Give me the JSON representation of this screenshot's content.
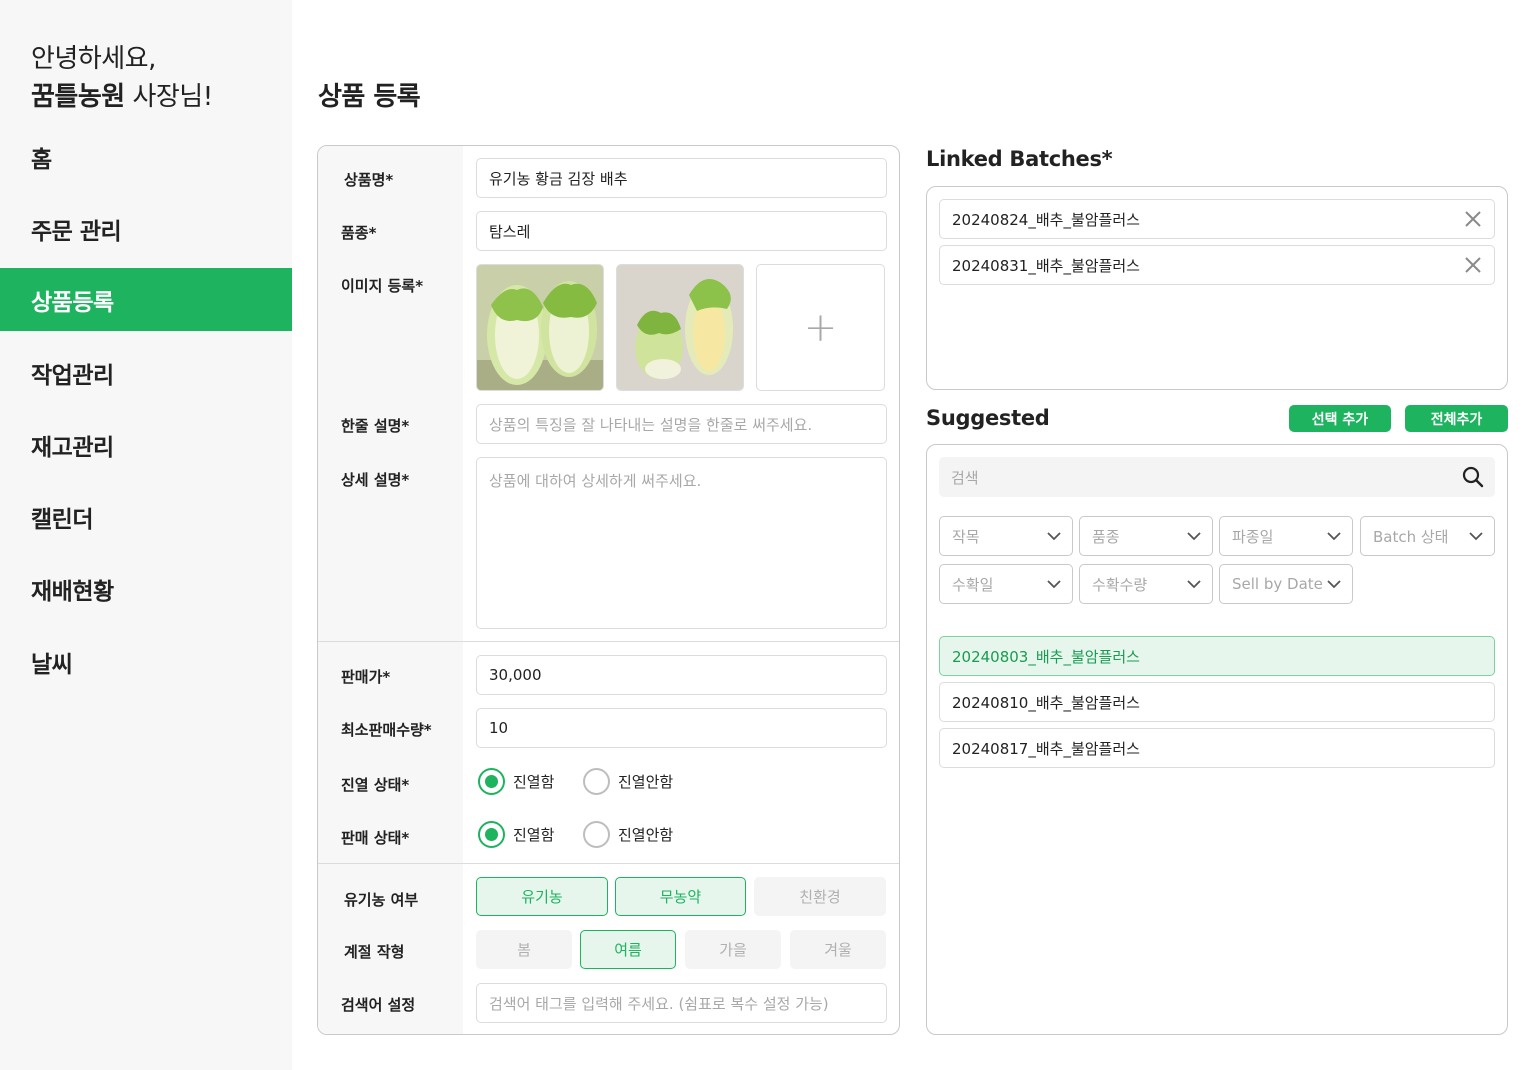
{
  "sidebar": {
    "greeting_line1": "안녕하세요,",
    "farm_name": "꿈틀농원",
    "greeting_suffix": " 사장님!",
    "items": [
      {
        "label": "홈"
      },
      {
        "label": "주문 관리"
      },
      {
        "label": "상품등록"
      },
      {
        "label": "작업관리"
      },
      {
        "label": "재고관리"
      },
      {
        "label": "캘린더"
      },
      {
        "label": "재배현황"
      },
      {
        "label": "날씨"
      }
    ],
    "active_index": 2
  },
  "page_title": "상품 등록",
  "form": {
    "product_name_label": "상품명*",
    "product_name_value": "유기농 황금 김장 배추",
    "variety_label": "품종*",
    "variety_value": "탐스레",
    "image_label": "이미지 등록*",
    "add_image_symbol": "+",
    "short_desc_label": "한줄 설명*",
    "short_desc_placeholder": "상품의 특징을 잘 나타내는 설명을 한줄로 써주세요.",
    "detail_desc_label": "상세 설명*",
    "detail_desc_placeholder": "상품에 대하여 상세하게 써주세요.",
    "price_label": "판매가*",
    "price_value": "30,000",
    "min_qty_label": "최소판매수량*",
    "min_qty_value": "10",
    "display_status_label": "진열 상태*",
    "display_options": [
      "진열함",
      "진열안함"
    ],
    "display_selected": "진열함",
    "sale_status_label": "판매 상태*",
    "sale_options": [
      "진열함",
      "진열안함"
    ],
    "sale_selected": "진열함",
    "organic_label": "유기농 여부",
    "organic_options": [
      {
        "label": "유기농",
        "selected": true
      },
      {
        "label": "무농약",
        "selected": true
      },
      {
        "label": "친환경",
        "selected": false
      }
    ],
    "season_label": "계절 작형",
    "season_options": [
      {
        "label": "봄",
        "selected": false
      },
      {
        "label": "여름",
        "selected": true
      },
      {
        "label": "가을",
        "selected": false
      },
      {
        "label": "겨울",
        "selected": false
      }
    ],
    "keyword_label": "검색어 설정",
    "keyword_placeholder": "검색어 태그를 입력해 주세요. (쉼표로 복수 설정 가능)"
  },
  "linked": {
    "title": "Linked Batches*",
    "items": [
      "20240824_배추_불암플러스",
      "20240831_배추_불암플러스"
    ]
  },
  "suggested": {
    "title": "Suggested",
    "add_selected_label": "선택 추가",
    "add_all_label": "전체추가",
    "search_placeholder": "검색",
    "filters_row1": [
      "작목",
      "품종",
      "파종일",
      "Batch 상태"
    ],
    "filters_row2": [
      "수확일",
      "수확수량",
      "Sell by Date"
    ],
    "items": [
      {
        "label": "20240803_배추_불암플러스",
        "highlighted": true
      },
      {
        "label": "20240810_배추_불암플러스",
        "highlighted": false
      },
      {
        "label": "20240817_배추_불암플러스",
        "highlighted": false
      }
    ]
  },
  "colors": {
    "accent": "#1db35f",
    "accent_light": "#e6f6ec",
    "sidebar_bg": "#f7f7f7"
  }
}
